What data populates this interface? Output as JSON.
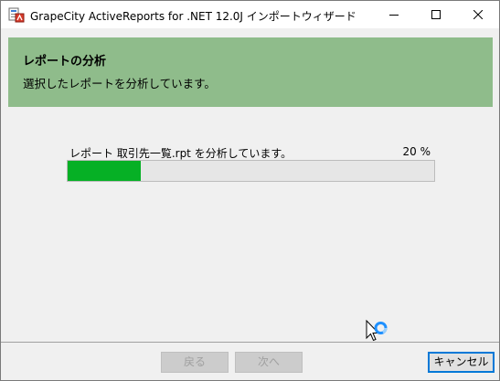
{
  "window": {
    "title": "GrapeCity ActiveReports for .NET 12.0J インポートウィザード",
    "icons": [
      "app-icon",
      "minimize-icon",
      "maximize-icon",
      "close-icon"
    ]
  },
  "header": {
    "title": "レポートの分析",
    "subtitle": "選択したレポートを分析しています。",
    "background_color": "#8fbc8b"
  },
  "progress": {
    "label": "レポート 取引先一覧.rpt を分析しています。",
    "percent_text": "20 %",
    "value": 0.2,
    "fill_color": "#06b025"
  },
  "footer": {
    "back_label": "戻る",
    "next_label": "次へ",
    "cancel_label": "キャンセル"
  },
  "cursor": {
    "icon": "busy-pointer-icon"
  }
}
